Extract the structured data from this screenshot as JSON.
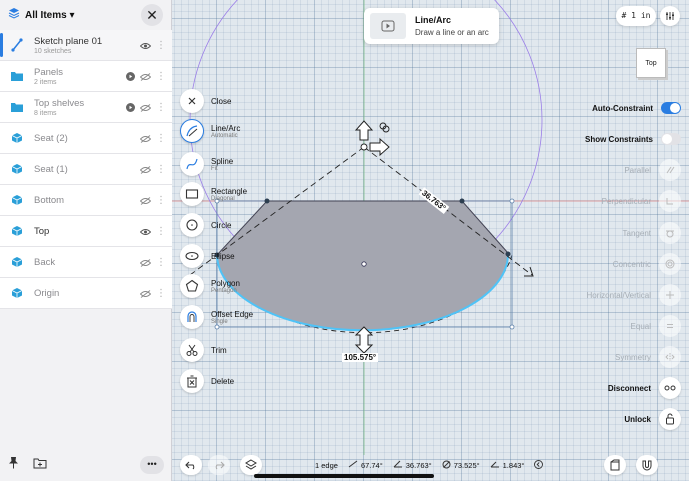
{
  "sidebar": {
    "header_title": "All Items ▾",
    "items": [
      {
        "name": "Sketch plane 01",
        "sub": "10 sketches"
      },
      {
        "name": "Panels",
        "sub": "2 items"
      },
      {
        "name": "Top shelves",
        "sub": "8 items"
      },
      {
        "name": "Seat (2)",
        "sub": ""
      },
      {
        "name": "Seat (1)",
        "sub": ""
      },
      {
        "name": "Bottom",
        "sub": ""
      },
      {
        "name": "Top",
        "sub": ""
      },
      {
        "name": "Back",
        "sub": ""
      },
      {
        "name": "Origin",
        "sub": ""
      }
    ],
    "footer_more": "•••"
  },
  "tooltip": {
    "title": "Line/Arc",
    "desc": "Draw a line or an arc"
  },
  "tools": [
    {
      "label": "Close",
      "sub": ""
    },
    {
      "label": "Line/Arc",
      "sub": "Automatic"
    },
    {
      "label": "Spline",
      "sub": "Fit"
    },
    {
      "label": "Rectangle",
      "sub": "Diagonal"
    },
    {
      "label": "Circle",
      "sub": ""
    },
    {
      "label": "Ellipse",
      "sub": ""
    },
    {
      "label": "Polygon",
      "sub": "Pentagon"
    },
    {
      "label": "Offset Edge",
      "sub": "Single"
    },
    {
      "label": "Trim",
      "sub": ""
    },
    {
      "label": "Delete",
      "sub": ""
    }
  ],
  "units": "# 1 in",
  "viewcube": "Top",
  "constraints": {
    "auto_constraint": "Auto-Constraint",
    "show_constraints": "Show Constraints",
    "items": [
      "Parallel",
      "Perpendicular",
      "Tangent",
      "Concentric",
      "Horizontal/Vertical",
      "Equal",
      "Symmetry"
    ],
    "disconnect": "Disconnect",
    "unlock": "Unlock"
  },
  "dimensions": {
    "angle_bottom": "105.575°",
    "diagonal": "36.763°"
  },
  "status": {
    "edges": "1 edge",
    "v1": "67.74°",
    "v2": "36.763°",
    "v3": "73.525°",
    "v4": "1.843°"
  },
  "colors": {
    "accent": "#2a7de1",
    "shape_fill": "#a4a6b0",
    "arc": "#4fc3f7",
    "circle": "#9b7ee8"
  }
}
